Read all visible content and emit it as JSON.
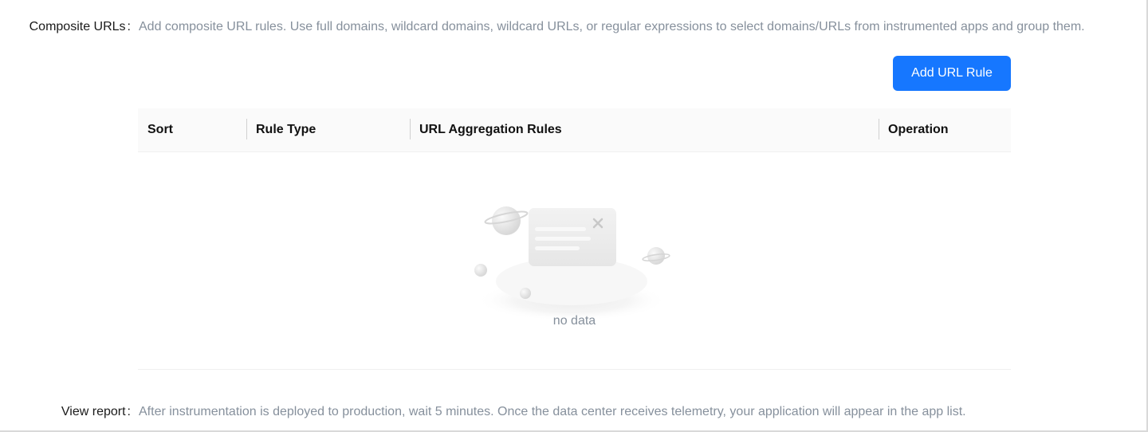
{
  "composite_urls": {
    "label": "Composite URLs",
    "colon": ":",
    "description": "Add composite URL rules. Use full domains, wildcard domains, wildcard URLs, or regular expressions to select domains/URLs from instrumented apps and group them."
  },
  "toolbar": {
    "add_rule_label": "Add URL Rule"
  },
  "table": {
    "columns": [
      "Sort",
      "Rule Type",
      "URL Aggregation Rules",
      "Operation"
    ],
    "rows": [],
    "empty_text": "no data",
    "empty_icon": "empty-state-illustration"
  },
  "view_report": {
    "label": "View report",
    "colon": ":",
    "description": "After instrumentation is deployed to production, wait 5 minutes. Once the data center receives telemetry, your application will appear in the app list."
  },
  "colors": {
    "accent": "#1677ff",
    "muted_text": "#86909c",
    "header_bg": "#fafafa"
  }
}
